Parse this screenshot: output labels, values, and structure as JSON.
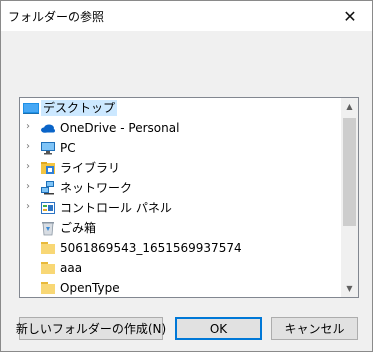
{
  "dialog": {
    "title": "フォルダーの参照"
  },
  "tree": {
    "items": [
      {
        "label": "デスクトップ",
        "icon": "desktop-icon",
        "selected": true,
        "expandable": false
      },
      {
        "label": "OneDrive - Personal",
        "icon": "onedrive-cloud-icon",
        "expandable": true
      },
      {
        "label": "PC",
        "icon": "pc-monitor-icon",
        "expandable": true
      },
      {
        "label": "ライブラリ",
        "icon": "library-icon",
        "expandable": true
      },
      {
        "label": "ネットワーク",
        "icon": "network-icon",
        "expandable": true
      },
      {
        "label": "コントロール パネル",
        "icon": "control-panel-icon",
        "expandable": true
      },
      {
        "label": "ごみ箱",
        "icon": "recycle-bin-icon",
        "expandable": false
      },
      {
        "label": "5061869543_1651569937574",
        "icon": "folder-icon",
        "expandable": false
      },
      {
        "label": "aaa",
        "icon": "folder-icon",
        "expandable": false
      },
      {
        "label": "OpenType",
        "icon": "folder-icon",
        "expandable": false
      }
    ]
  },
  "buttons": {
    "new_folder": "新しいフォルダーの作成(N)",
    "ok": "OK",
    "cancel": "キャンセル"
  },
  "colors": {
    "selection": "#cce8ff",
    "default_button_border": "#0078d7"
  }
}
